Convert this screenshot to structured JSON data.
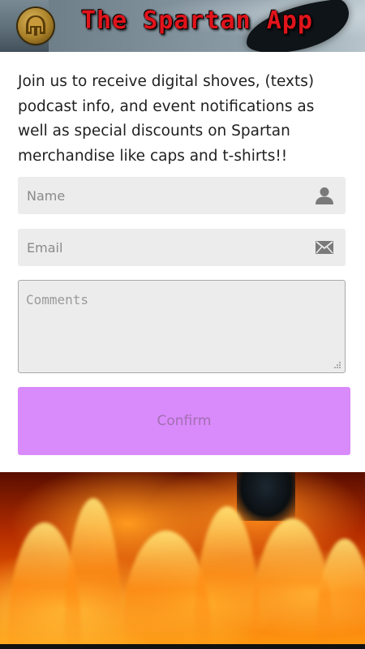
{
  "header": {
    "app_title": "The Spartan App",
    "logo_icon": "spartan-helmet-icon"
  },
  "intro_text": "Join us to receive digital shoves, (texts) podcast info, and event notifications as well as special discounts on Spartan merchandise like caps and t-shirts!!",
  "form": {
    "name_placeholder": "Name",
    "name_icon": "user-icon",
    "email_placeholder": "Email",
    "email_icon": "envelope-icon",
    "comments_placeholder": "Comments",
    "confirm_label": "Confirm"
  },
  "colors": {
    "title_red": "#e0141b",
    "confirm_button": "#d98afb",
    "field_background": "#ececec"
  }
}
